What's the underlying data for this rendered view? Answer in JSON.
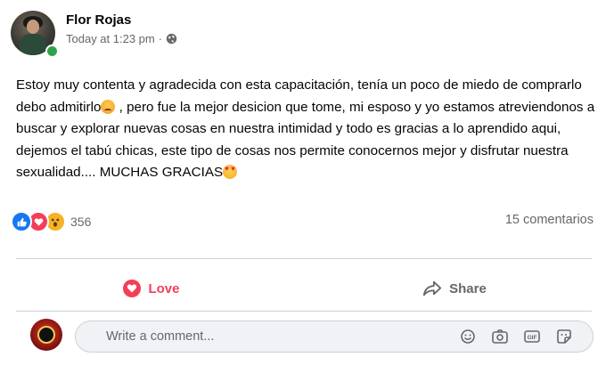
{
  "post": {
    "author": "Flor Rojas",
    "time": "Today at 1:23 pm",
    "separator": "·",
    "privacy_icon": "globe-icon",
    "text_part1": "Estoy muy contenta y agradecida con esta capacitación, tenía un poco de miedo de comprarlo debo admitirlo",
    "emoji1": "angry-face-emoji",
    "text_part2": " , pero fue la mejor desicion que tome, mi esposo y yo estamos atreviendonos a buscar y explorar nuevas cosas en nuestra intimidad y todo es gracias a lo aprendido aqui, dejemos el tabú chicas, este tipo de cosas nos permite conocernos mejor y disfrutar nuestra sexualidad.... MUCHAS GRACIAS",
    "emoji2": "heart-eyes-emoji"
  },
  "reactions": {
    "icons": [
      "like-icon",
      "love-icon",
      "wow-icon"
    ],
    "count": "356",
    "comments": "15 comentarios"
  },
  "actions": {
    "love_label": "Love",
    "share_label": "Share"
  },
  "comment": {
    "placeholder": "Write a comment...",
    "icons": [
      "emoji-icon",
      "camera-icon",
      "gif-icon",
      "sticker-icon"
    ]
  },
  "colors": {
    "love": "#f33e58",
    "like": "#1877f2",
    "wow": "#f7b125",
    "secondary_text": "#65676b",
    "online": "#31a24c"
  }
}
